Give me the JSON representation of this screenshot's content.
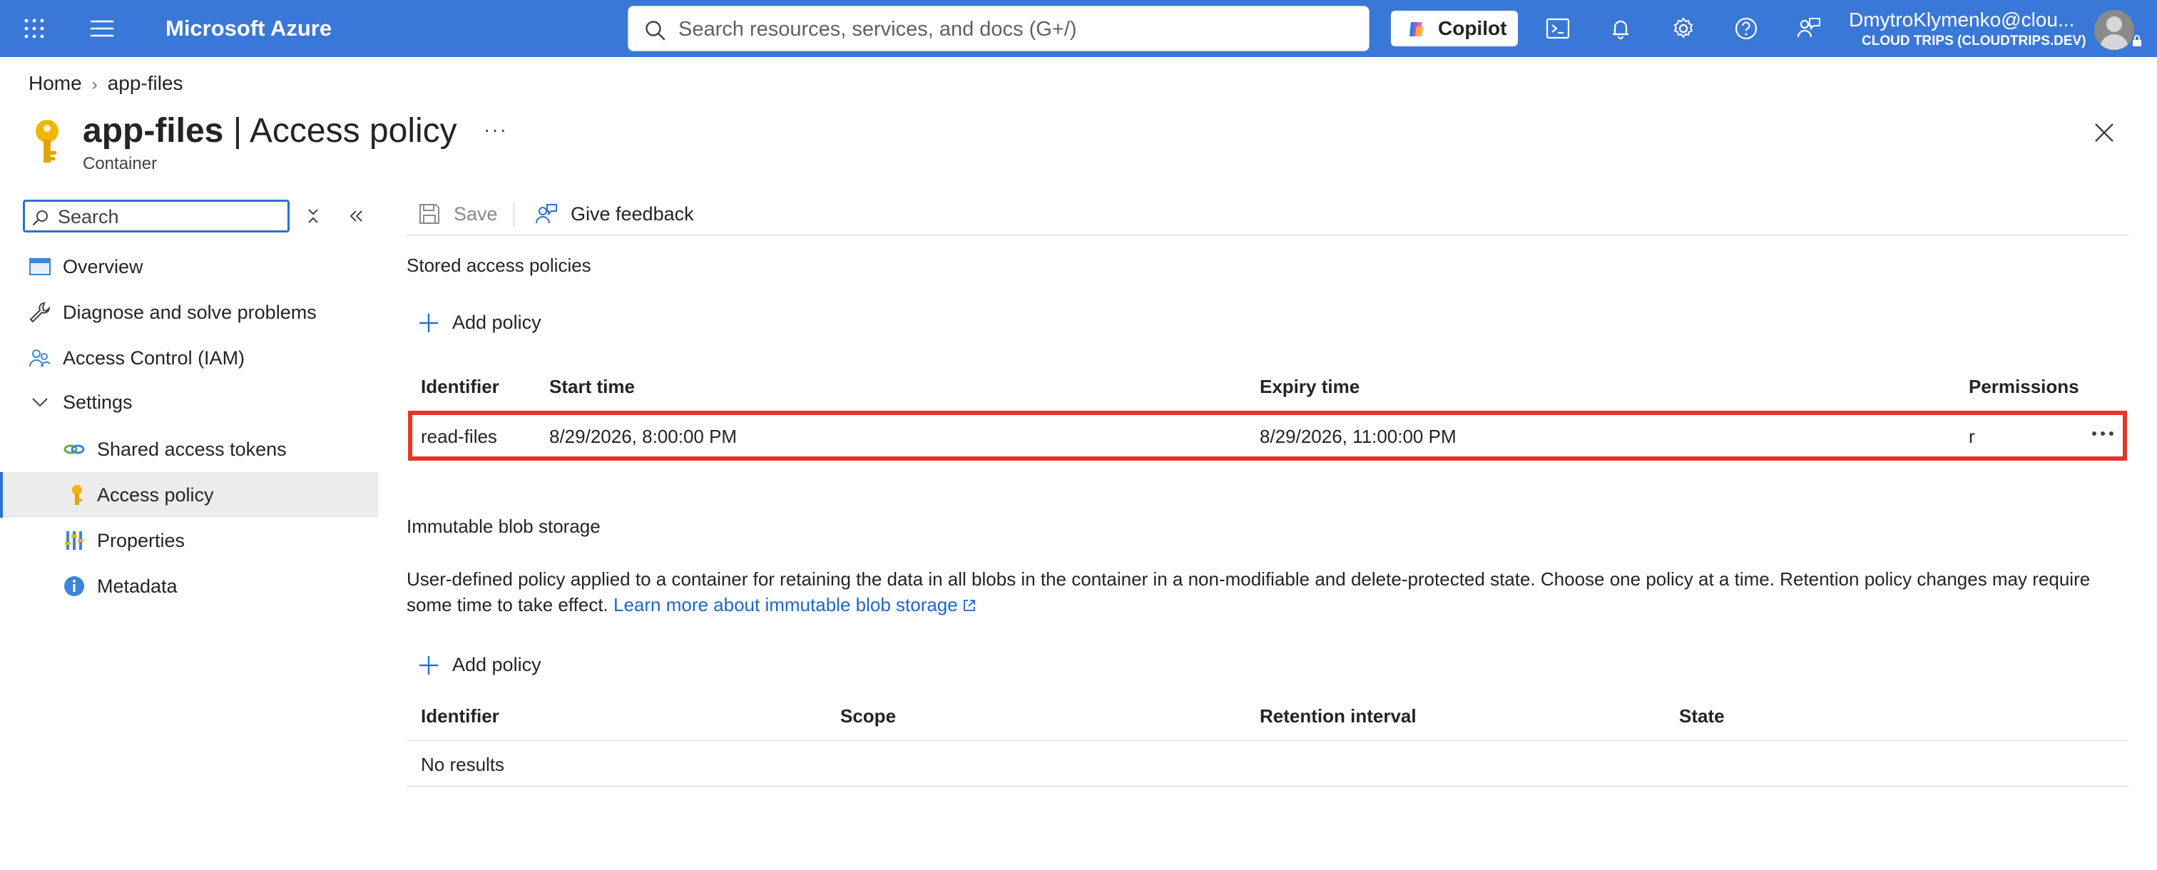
{
  "topbar": {
    "brand": "Microsoft Azure",
    "search_placeholder": "Search resources, services, and docs (G+/)",
    "copilot_label": "Copilot",
    "user_name": "DmytroKlymenko@clou...",
    "user_tenant": "CLOUD TRIPS (CLOUDTRIPS.DEV)",
    "bar_color": "#3a78d8"
  },
  "breadcrumb": {
    "home": "Home",
    "current": "app-files"
  },
  "header": {
    "resource_name": "app-files",
    "separator": "|",
    "page_name": "Access policy",
    "resource_type": "Container",
    "more": "···"
  },
  "nav": {
    "search_placeholder": "Search",
    "items": [
      {
        "label": "Overview",
        "icon": "overview-icon"
      },
      {
        "label": "Diagnose and solve problems",
        "icon": "wrench-icon"
      },
      {
        "label": "Access Control (IAM)",
        "icon": "people-icon"
      },
      {
        "label": "Settings",
        "icon": "chevron-down-icon"
      },
      {
        "label": "Shared access tokens",
        "icon": "link-icon"
      },
      {
        "label": "Access policy",
        "icon": "key-icon",
        "active": true
      },
      {
        "label": "Properties",
        "icon": "properties-icon"
      },
      {
        "label": "Metadata",
        "icon": "info-icon"
      }
    ]
  },
  "toolbar": {
    "save_label": "Save",
    "feedback_label": "Give feedback"
  },
  "stored_policies": {
    "section_title": "Stored access policies",
    "add_label": "Add policy",
    "columns": [
      "Identifier",
      "Start time",
      "Expiry time",
      "Permissions"
    ],
    "rows": [
      {
        "identifier": "read-files",
        "start": "8/29/2026, 8:00:00 PM",
        "expiry": "8/29/2026, 11:00:00 PM",
        "permissions": "r"
      }
    ],
    "highlight_color": "#e4372a"
  },
  "immutable": {
    "section_title": "Immutable blob storage",
    "description": "User-defined policy applied to a container for retaining the data in all blobs in the container in a non-modifiable and delete-protected state. Choose one policy at a time. Retention policy changes may require some time to take effect.",
    "learn_more": "Learn more about immutable blob storage",
    "add_label": "Add policy",
    "columns": [
      "Identifier",
      "Scope",
      "Retention interval",
      "State"
    ],
    "empty_text": "No results"
  }
}
